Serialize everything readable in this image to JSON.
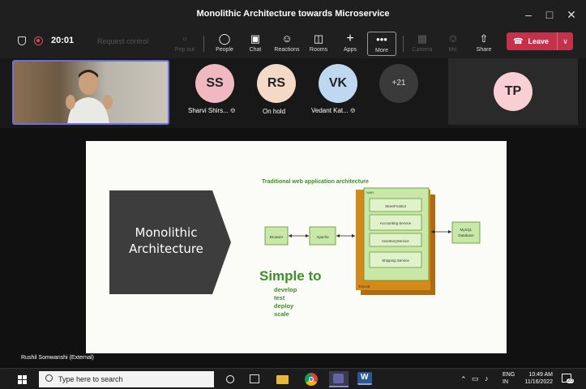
{
  "window": {
    "title": "Monolithic Architecture towards Microservice"
  },
  "toolbar": {
    "timer": "20:01",
    "request_control": "Request control",
    "pop_out": "Pop out",
    "people": "People",
    "chat": "Chat",
    "reactions": "Reactions",
    "rooms": "Rooms",
    "apps": "Apps",
    "more": "More",
    "camera": "Camera",
    "mic": "Mic",
    "share": "Share",
    "leave": "Leave"
  },
  "participants": [
    {
      "initials": "SS",
      "name": "Sharvi Shirs...",
      "color": "#f0b9c2"
    },
    {
      "initials": "RS",
      "name": "On hold",
      "color": "#f3d9c6"
    },
    {
      "initials": "VK",
      "name": "Vedant Kat...",
      "color": "#bfd8f2"
    }
  ],
  "overflow_count": "+21",
  "spotlight": {
    "initials": "TP",
    "color": "#f7cfd4"
  },
  "slide": {
    "chevron_text_line1": "Monolithic",
    "chevron_text_line2": "Architecture",
    "diagram_title": "Traditional web application architecture",
    "war_label": "WAR",
    "tomcat_label": "Tomcat",
    "browser": "Browser",
    "apache": "Apache",
    "services": [
      "StoreFrontUI",
      "Accounting Service",
      "InventoryService",
      "Shipping Service"
    ],
    "db_line1": "MySQL",
    "db_line2": "Database",
    "headline": "Simple to",
    "bullets": [
      "develop",
      "test",
      "deploy",
      "scale"
    ]
  },
  "presenter": "Rushil Somwanshi (External)",
  "taskbar": {
    "search_placeholder": "Type here to search",
    "lang1": "ENG",
    "lang2": "IN",
    "time": "10:49 AM",
    "date": "11/16/2022",
    "notifications": "20"
  },
  "colors": {
    "leave": "#c4314b",
    "accent": "#6b6fd6",
    "slide_green": "#3f8f2a",
    "tomcat": "#d38a1b",
    "chevron": "#3d3d3d"
  }
}
